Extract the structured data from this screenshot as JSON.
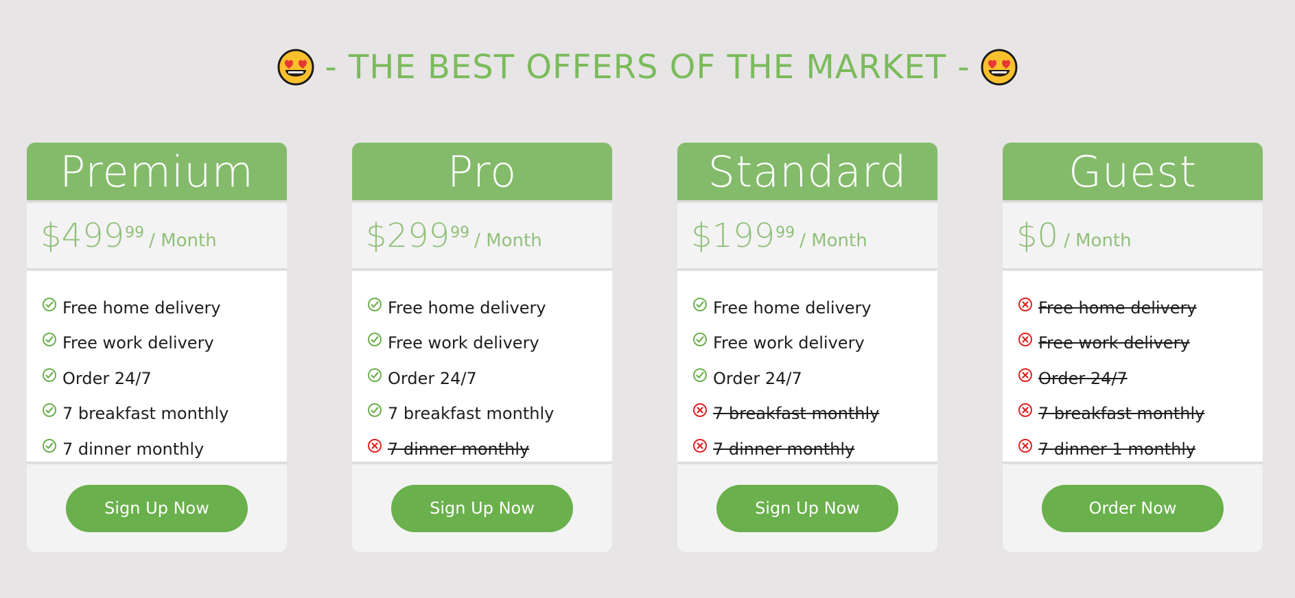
{
  "headline": {
    "text": "- THE BEST OFFERS OF THE MARKET -",
    "emoji": "heart-eyes-emoji"
  },
  "colors": {
    "accent": "#6ab04c",
    "header": "#84bb6b",
    "price": "#91c07a",
    "check": "#6ab04c",
    "cross": "#e02020",
    "background": "#e7e5e6"
  },
  "plans": [
    {
      "name": "Premium",
      "currency": "$",
      "price": "499",
      "cents": "99",
      "period": "/ Month",
      "features": [
        {
          "text": "Free home delivery",
          "included": true
        },
        {
          "text": "Free work delivery",
          "included": true
        },
        {
          "text": "Order 24/7",
          "included": true
        },
        {
          "text": "7 breakfast monthly",
          "included": true
        },
        {
          "text": "7 dinner monthly",
          "included": true
        }
      ],
      "cta": "Sign Up Now"
    },
    {
      "name": "Pro",
      "currency": "$",
      "price": "299",
      "cents": "99",
      "period": "/ Month",
      "features": [
        {
          "text": "Free home delivery",
          "included": true
        },
        {
          "text": "Free work delivery",
          "included": true
        },
        {
          "text": "Order 24/7",
          "included": true
        },
        {
          "text": "7 breakfast monthly",
          "included": true
        },
        {
          "text": "7 dinner monthly",
          "included": false
        }
      ],
      "cta": "Sign Up Now"
    },
    {
      "name": "Standard",
      "currency": "$",
      "price": "199",
      "cents": "99",
      "period": "/ Month",
      "features": [
        {
          "text": "Free home delivery",
          "included": true
        },
        {
          "text": "Free work delivery",
          "included": true
        },
        {
          "text": "Order 24/7",
          "included": true
        },
        {
          "text": "7 breakfast monthly",
          "included": false
        },
        {
          "text": "7 dinner monthly",
          "included": false
        }
      ],
      "cta": "Sign Up Now"
    },
    {
      "name": "Guest",
      "currency": "$",
      "price": "0",
      "cents": "",
      "period": "/ Month",
      "features": [
        {
          "text": "Free home delivery",
          "included": false
        },
        {
          "text": "Free work delivery",
          "included": false
        },
        {
          "text": "Order 24/7",
          "included": false
        },
        {
          "text": "7 breakfast monthly",
          "included": false
        },
        {
          "text": "7 dinner 1 monthly",
          "included": false
        }
      ],
      "cta": "Order Now"
    }
  ]
}
